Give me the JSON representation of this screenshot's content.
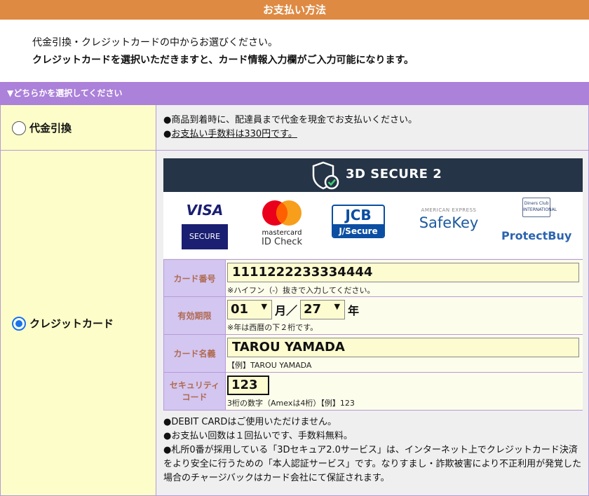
{
  "header": {
    "title": "お支払い方法"
  },
  "intro": {
    "line1": "代金引換・クレジットカードの中からお選びください。",
    "line2": "クレジットカードを選択いただきますと、カード情報入力欄がご入力可能になります。"
  },
  "select_prompt": "▼どちらかを選択してください",
  "cod": {
    "label": "代金引換",
    "selected": false,
    "note1": "●商品到着時に、配達員まで代金を現金でお支払いください。",
    "note2_prefix": "●",
    "note2_text": "お支払い手数料は330円です。"
  },
  "credit": {
    "label": "クレジットカード",
    "selected": true,
    "secure_banner": "3D SECURE 2",
    "logos": {
      "visa": "VISA",
      "visa_sub": "SECURE",
      "mc_word": "mastercard",
      "mc_sub": "ID Check",
      "jcb": "JCB",
      "jcb_sub": "J/Secure",
      "amex_top": "AMERICAN EXPRESS",
      "amex_main": "SafeKey",
      "diners_top": "Diners Club",
      "diners_sub": "INTERNATIONAL",
      "diners_main": "ProtectBuy"
    },
    "form": {
      "card_number_label": "カード番号",
      "card_number_value": "1111222233334444",
      "card_number_hint": "※ハイフン（-）抜きで入力してください。",
      "expiry_label": "有効期限",
      "expiry_month": "01",
      "expiry_month_unit": "月／",
      "expiry_year": "27",
      "expiry_year_unit": "年",
      "expiry_hint": "※年は西暦の下２桁です。",
      "name_label": "カード名義",
      "name_value": "TAROU YAMADA",
      "name_hint": "【例】TAROU YAMADA",
      "cvc_label_1": "セキュリティ",
      "cvc_label_2": "コード",
      "cvc_value": "123",
      "cvc_hint": "3桁の数字（Amexは4桁）【例】123"
    },
    "notes": {
      "n1": "●DEBIT CARDはご使用いただけません。",
      "n2": "●お支払い回数は１回払いです、手数料無料。",
      "n3": "●札所0番が採用している「3Dセキュア2.0サービス」は、インターネット上でクレジットカード決済をより安全に行うための「本人認証サービス」です。なりすまし・詐欺被害により不正利用が発覚した場合のチャージバックはカード会社にて保証されます。"
    }
  },
  "colors": {
    "header_orange": "#de8a43",
    "purple_bar": "#ab81d9",
    "label_bg": "#d3c6f1",
    "left_cell_bg": "#fdfdc9",
    "secure_banner": "#253446",
    "radio_blue": "#1a73e8"
  }
}
